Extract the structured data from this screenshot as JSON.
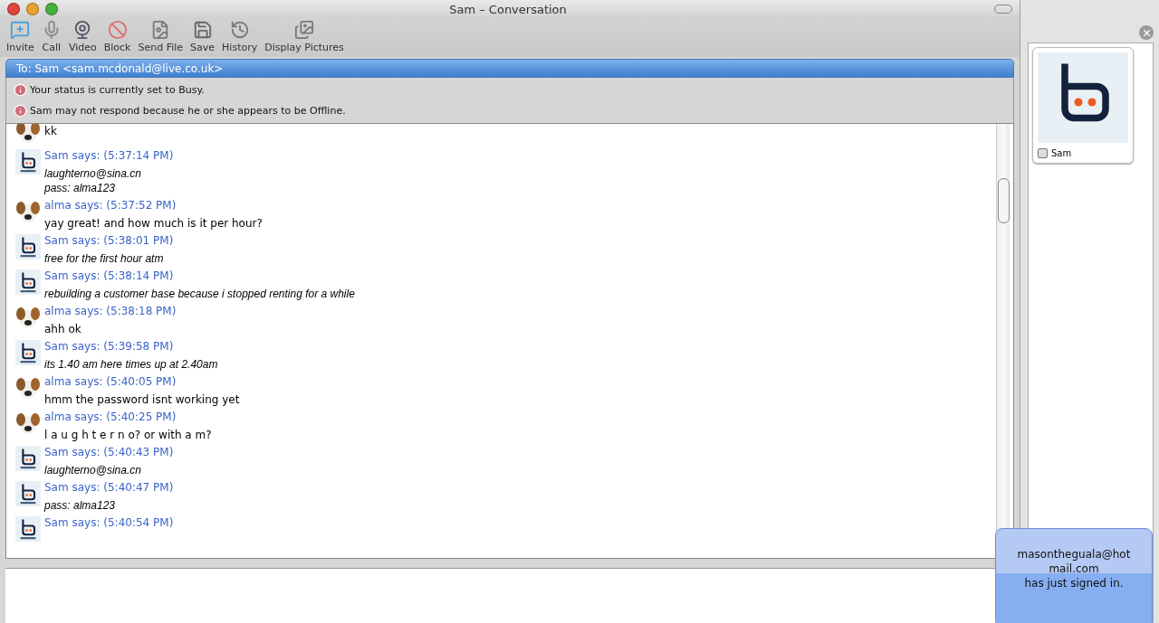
{
  "window": {
    "title": "Sam – Conversation"
  },
  "toolbar": [
    {
      "label": "Invite",
      "kind": "invite"
    },
    {
      "label": "Call",
      "kind": "call"
    },
    {
      "label": "Video",
      "kind": "video"
    },
    {
      "label": "Block",
      "kind": "block"
    },
    {
      "label": "Send File",
      "kind": "file"
    },
    {
      "label": "Save",
      "kind": "save"
    },
    {
      "label": "History",
      "kind": "history"
    },
    {
      "label": "Display Pictures",
      "kind": "pictures"
    }
  ],
  "recipient": "To: Sam <sam.mcdonald@live.co.uk>",
  "notices": [
    "Your status is currently set to Busy.",
    "Sam may not respond because he or she appears to be Offline."
  ],
  "messages": [
    {
      "kind": "alma",
      "lines": [
        "kk"
      ]
    },
    {
      "kind": "sam",
      "header": "Sam says: (5:37:14 PM)",
      "lines": [
        "laughterno@sina.cn",
        "pass: alma123"
      ]
    },
    {
      "kind": "alma",
      "header": "alma says: (5:37:52 PM)",
      "lines": [
        "yay great! and how much is it per hour?"
      ]
    },
    {
      "kind": "sam",
      "header": "Sam says: (5:38:01 PM)",
      "lines": [
        "free for the first hour atm"
      ]
    },
    {
      "kind": "sam",
      "header": "Sam says: (5:38:14 PM)",
      "lines": [
        "rebuilding a customer base because i stopped renting for a while"
      ]
    },
    {
      "kind": "alma",
      "header": "alma says: (5:38:18 PM)",
      "lines": [
        "ahh ok"
      ]
    },
    {
      "kind": "sam",
      "header": "Sam says: (5:39:58 PM)",
      "lines": [
        "its 1.40 am here times up at 2.40am"
      ]
    },
    {
      "kind": "alma",
      "header": "alma says: (5:40:05 PM)",
      "lines": [
        "hmm the password isnt working yet"
      ]
    },
    {
      "kind": "alma",
      "header": "alma says: (5:40:25 PM)",
      "lines": [
        "l a u g h t e r n o? or with a m?"
      ]
    },
    {
      "kind": "sam",
      "header": "Sam says: (5:40:43 PM)",
      "lines": [
        "laughterno@sina.cn"
      ]
    },
    {
      "kind": "sam",
      "header": "Sam says: (5:40:47 PM)",
      "lines": [
        "pass: alma123"
      ]
    },
    {
      "kind": "sam",
      "header": "Sam says: (5:40:54 PM)"
    }
  ],
  "side_panel": {
    "contact_name": "Sam"
  },
  "notification": {
    "lines": [
      "masontheguala@hot",
      "mail.com",
      "has just signed in."
    ]
  }
}
